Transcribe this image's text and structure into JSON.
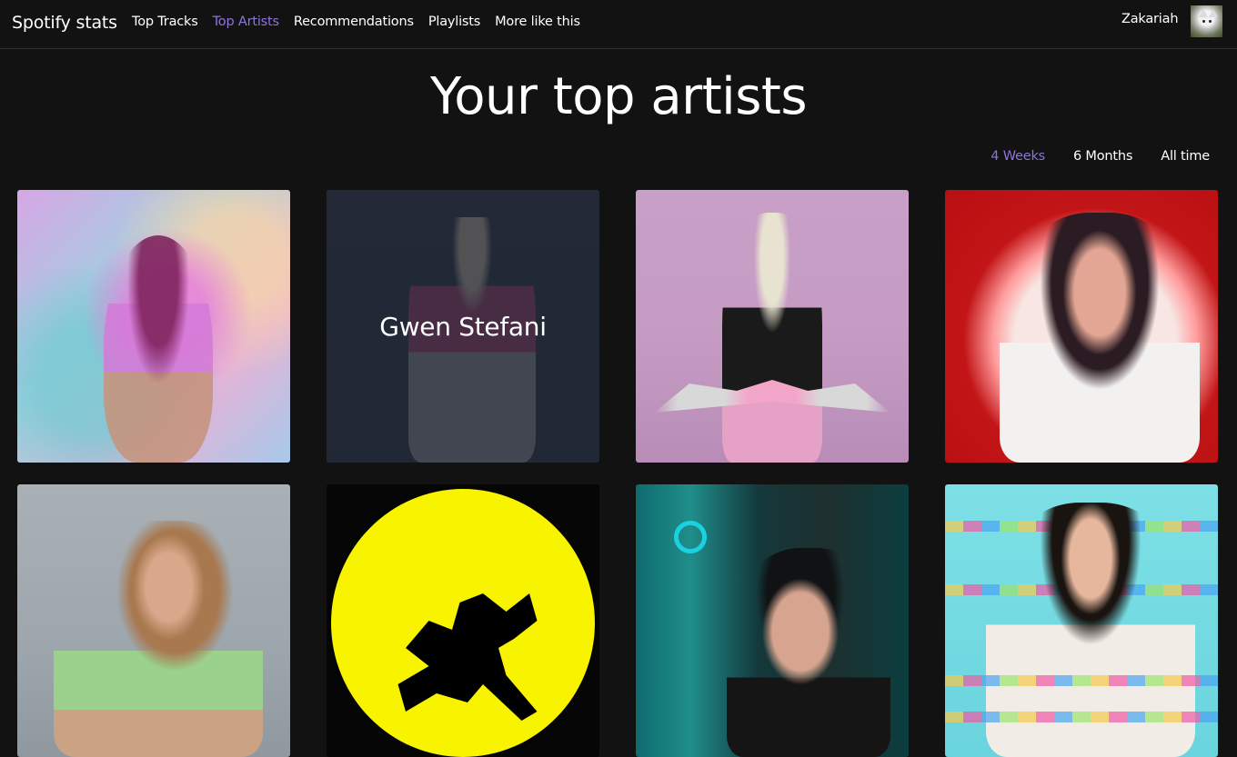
{
  "brand": "Spotify stats",
  "nav": {
    "items": [
      {
        "label": "Top Tracks",
        "active": false
      },
      {
        "label": "Top Artists",
        "active": true
      },
      {
        "label": "Recommendations",
        "active": false
      },
      {
        "label": "Playlists",
        "active": false
      },
      {
        "label": "More like this",
        "active": false
      }
    ]
  },
  "user": {
    "name": "Zakariah"
  },
  "page": {
    "title": "Your top artists"
  },
  "range": {
    "options": [
      {
        "label": "4 Weeks",
        "active": true
      },
      {
        "label": "6 Months",
        "active": false
      },
      {
        "label": "All time",
        "active": false
      }
    ]
  },
  "artists": [
    {
      "hover_label": ""
    },
    {
      "hover_label": "Gwen Stefani"
    },
    {
      "hover_label": ""
    },
    {
      "hover_label": ""
    },
    {
      "hover_label": ""
    },
    {
      "hover_label": ""
    },
    {
      "hover_label": ""
    },
    {
      "hover_label": ""
    }
  ],
  "colors": {
    "accent": "#8e74e0",
    "background": "#121212"
  }
}
